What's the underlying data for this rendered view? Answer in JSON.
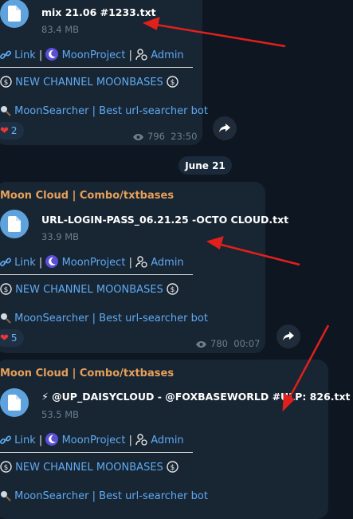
{
  "date_divider": "June 21",
  "channel_links": {
    "link": "Link",
    "project": "MoonProject",
    "admin": "Admin",
    "sep": "|"
  },
  "messages": [
    {
      "sender": "",
      "file_name": "mix 21.06 #1233.txt",
      "file_size": "83.4 MB",
      "new_channel": "NEW CHANNEL MOONBASES",
      "searcher": "MoonSearcher | Best url-searcher bot",
      "reaction_count": "2",
      "views": "796",
      "time": "23:50"
    },
    {
      "sender": "Moon Cloud | Combo/txtbases",
      "file_name": "URL-LOGIN-PASS_06.21.25 -OCTO CLOUD.txt",
      "file_size": "33.9 MB",
      "new_channel": "NEW CHANNEL MOONBASES",
      "searcher": "MoonSearcher | Best url-searcher bot",
      "reaction_count": "5",
      "views": "780",
      "time": "00:07"
    },
    {
      "sender": "Moon Cloud | Combo/txtbases",
      "file_name": "⚡ @UP_DAISYCLOUD - @FOXBASEWORLD #ULP: 826.txt",
      "file_size": "53.5 MB",
      "new_channel": "NEW CHANNEL MOONBASES",
      "searcher": "MoonSearcher | Best url-searcher bot"
    }
  ],
  "colors": {
    "background": "#0e1621",
    "bubble": "#182533",
    "sender": "#e6a05a",
    "link": "#5eaaf1",
    "annotation_arrow": "#e0201c"
  },
  "icons": [
    "file-icon",
    "link-icon",
    "moon-icon",
    "admin-icon",
    "dollar-coin-icon",
    "magnifier-icon",
    "heart-icon",
    "eye-icon",
    "share-icon"
  ]
}
